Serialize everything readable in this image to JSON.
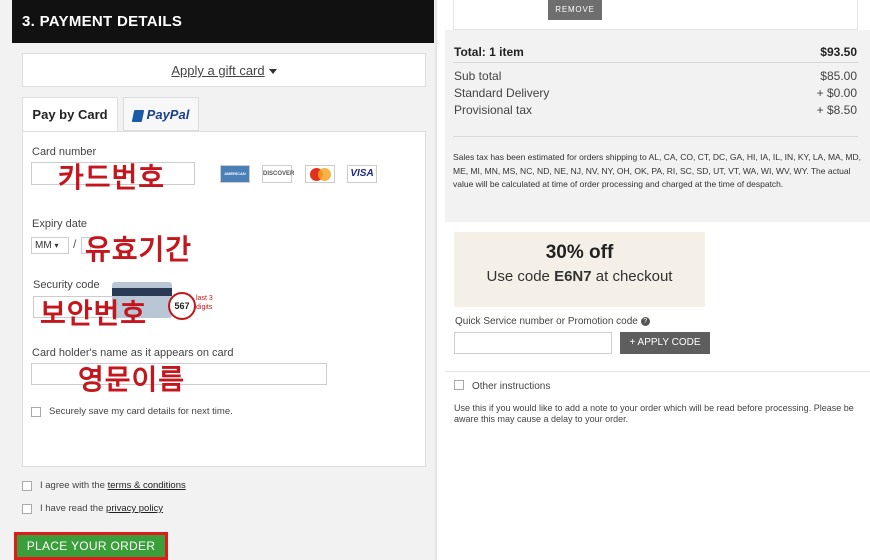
{
  "payment": {
    "section_title": "3. PAYMENT DETAILS",
    "gift_card_link": "Apply a gift card",
    "tabs": {
      "card": "Pay by Card",
      "paypal": "PayPal"
    },
    "card_number_label": "Card number",
    "card_number_note": "카드번호",
    "card_logos": {
      "amex": "AMERICAN EXPRESS",
      "discover": "DISCOVER",
      "mastercard": "MasterCard",
      "visa": "VISA"
    },
    "expiry_label": "Expiry date",
    "expiry_month": "MM",
    "expiry_slash": "/",
    "expiry_note": "유효기간",
    "security_label": "Security code",
    "security_note": "보안번호",
    "security_sample": "567",
    "security_hint": "last 3 digits",
    "holder_label": "Card holder's name as it appears on card",
    "holder_note": "영문이름",
    "save_card": "Securely save my card details for next time.",
    "agree_prefix": "I agree with the ",
    "terms_link": "terms & conditions",
    "read_prefix": "I have read the ",
    "privacy_link": "privacy policy",
    "place_order": "PLACE YOUR ORDER"
  },
  "summary": {
    "remove_button": "REMOVE",
    "total_label": "Total: 1 item",
    "total_value": "$93.50",
    "subtotal_label": "Sub total",
    "subtotal_value": "$85.00",
    "delivery_label": "Standard Delivery",
    "delivery_value": "+ $0.00",
    "tax_label": "Provisional tax",
    "tax_value": "+ $8.50",
    "tax_note": "Sales tax has been estimated for orders shipping to AL, CA, CO, CT, DC, GA, HI, IA, IL, IN, KY, LA, MA, MD, ME, MI, MN, MS, NC, ND, NE, NJ, NV, NY, OH, OK, PA, RI, SC, SD, UT, VT, WA, WI, WV, WY. The actual value will be calculated at time of order processing and charged at the time of despatch."
  },
  "promo": {
    "headline": "30% off",
    "line_prefix": "Use code ",
    "code": "E6N7",
    "line_suffix": " at checkout",
    "field_label": "Quick Service number or Promotion code",
    "apply_button": "+ APPLY CODE"
  },
  "instructions": {
    "label": "Other instructions",
    "note": "Use this if you would like to add a note to your order which will be read before processing. Please be aware this may cause a delay to your order."
  }
}
